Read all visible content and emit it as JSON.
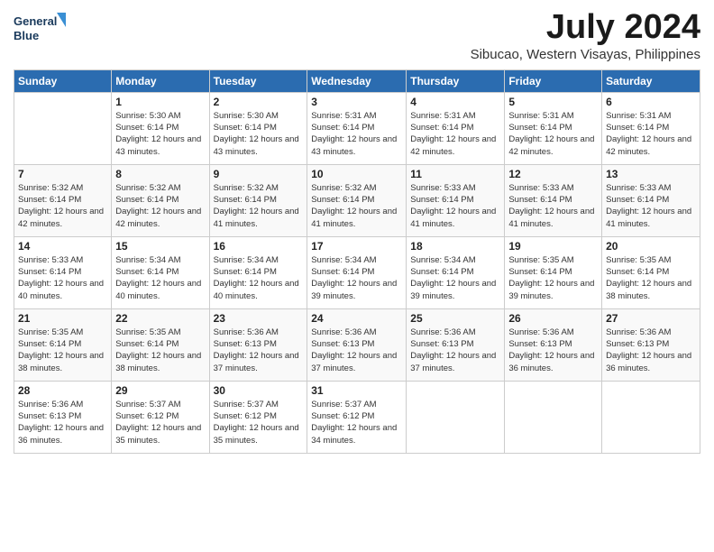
{
  "logo": {
    "line1": "General",
    "line2": "Blue"
  },
  "title": "July 2024",
  "location": "Sibucao, Western Visayas, Philippines",
  "weekdays": [
    "Sunday",
    "Monday",
    "Tuesday",
    "Wednesday",
    "Thursday",
    "Friday",
    "Saturday"
  ],
  "weeks": [
    [
      {
        "day": "",
        "sunrise": "",
        "sunset": "",
        "daylight": ""
      },
      {
        "day": "1",
        "sunrise": "Sunrise: 5:30 AM",
        "sunset": "Sunset: 6:14 PM",
        "daylight": "Daylight: 12 hours and 43 minutes."
      },
      {
        "day": "2",
        "sunrise": "Sunrise: 5:30 AM",
        "sunset": "Sunset: 6:14 PM",
        "daylight": "Daylight: 12 hours and 43 minutes."
      },
      {
        "day": "3",
        "sunrise": "Sunrise: 5:31 AM",
        "sunset": "Sunset: 6:14 PM",
        "daylight": "Daylight: 12 hours and 43 minutes."
      },
      {
        "day": "4",
        "sunrise": "Sunrise: 5:31 AM",
        "sunset": "Sunset: 6:14 PM",
        "daylight": "Daylight: 12 hours and 42 minutes."
      },
      {
        "day": "5",
        "sunrise": "Sunrise: 5:31 AM",
        "sunset": "Sunset: 6:14 PM",
        "daylight": "Daylight: 12 hours and 42 minutes."
      },
      {
        "day": "6",
        "sunrise": "Sunrise: 5:31 AM",
        "sunset": "Sunset: 6:14 PM",
        "daylight": "Daylight: 12 hours and 42 minutes."
      }
    ],
    [
      {
        "day": "7",
        "sunrise": "Sunrise: 5:32 AM",
        "sunset": "Sunset: 6:14 PM",
        "daylight": "Daylight: 12 hours and 42 minutes."
      },
      {
        "day": "8",
        "sunrise": "Sunrise: 5:32 AM",
        "sunset": "Sunset: 6:14 PM",
        "daylight": "Daylight: 12 hours and 42 minutes."
      },
      {
        "day": "9",
        "sunrise": "Sunrise: 5:32 AM",
        "sunset": "Sunset: 6:14 PM",
        "daylight": "Daylight: 12 hours and 41 minutes."
      },
      {
        "day": "10",
        "sunrise": "Sunrise: 5:32 AM",
        "sunset": "Sunset: 6:14 PM",
        "daylight": "Daylight: 12 hours and 41 minutes."
      },
      {
        "day": "11",
        "sunrise": "Sunrise: 5:33 AM",
        "sunset": "Sunset: 6:14 PM",
        "daylight": "Daylight: 12 hours and 41 minutes."
      },
      {
        "day": "12",
        "sunrise": "Sunrise: 5:33 AM",
        "sunset": "Sunset: 6:14 PM",
        "daylight": "Daylight: 12 hours and 41 minutes."
      },
      {
        "day": "13",
        "sunrise": "Sunrise: 5:33 AM",
        "sunset": "Sunset: 6:14 PM",
        "daylight": "Daylight: 12 hours and 41 minutes."
      }
    ],
    [
      {
        "day": "14",
        "sunrise": "Sunrise: 5:33 AM",
        "sunset": "Sunset: 6:14 PM",
        "daylight": "Daylight: 12 hours and 40 minutes."
      },
      {
        "day": "15",
        "sunrise": "Sunrise: 5:34 AM",
        "sunset": "Sunset: 6:14 PM",
        "daylight": "Daylight: 12 hours and 40 minutes."
      },
      {
        "day": "16",
        "sunrise": "Sunrise: 5:34 AM",
        "sunset": "Sunset: 6:14 PM",
        "daylight": "Daylight: 12 hours and 40 minutes."
      },
      {
        "day": "17",
        "sunrise": "Sunrise: 5:34 AM",
        "sunset": "Sunset: 6:14 PM",
        "daylight": "Daylight: 12 hours and 39 minutes."
      },
      {
        "day": "18",
        "sunrise": "Sunrise: 5:34 AM",
        "sunset": "Sunset: 6:14 PM",
        "daylight": "Daylight: 12 hours and 39 minutes."
      },
      {
        "day": "19",
        "sunrise": "Sunrise: 5:35 AM",
        "sunset": "Sunset: 6:14 PM",
        "daylight": "Daylight: 12 hours and 39 minutes."
      },
      {
        "day": "20",
        "sunrise": "Sunrise: 5:35 AM",
        "sunset": "Sunset: 6:14 PM",
        "daylight": "Daylight: 12 hours and 38 minutes."
      }
    ],
    [
      {
        "day": "21",
        "sunrise": "Sunrise: 5:35 AM",
        "sunset": "Sunset: 6:14 PM",
        "daylight": "Daylight: 12 hours and 38 minutes."
      },
      {
        "day": "22",
        "sunrise": "Sunrise: 5:35 AM",
        "sunset": "Sunset: 6:14 PM",
        "daylight": "Daylight: 12 hours and 38 minutes."
      },
      {
        "day": "23",
        "sunrise": "Sunrise: 5:36 AM",
        "sunset": "Sunset: 6:13 PM",
        "daylight": "Daylight: 12 hours and 37 minutes."
      },
      {
        "day": "24",
        "sunrise": "Sunrise: 5:36 AM",
        "sunset": "Sunset: 6:13 PM",
        "daylight": "Daylight: 12 hours and 37 minutes."
      },
      {
        "day": "25",
        "sunrise": "Sunrise: 5:36 AM",
        "sunset": "Sunset: 6:13 PM",
        "daylight": "Daylight: 12 hours and 37 minutes."
      },
      {
        "day": "26",
        "sunrise": "Sunrise: 5:36 AM",
        "sunset": "Sunset: 6:13 PM",
        "daylight": "Daylight: 12 hours and 36 minutes."
      },
      {
        "day": "27",
        "sunrise": "Sunrise: 5:36 AM",
        "sunset": "Sunset: 6:13 PM",
        "daylight": "Daylight: 12 hours and 36 minutes."
      }
    ],
    [
      {
        "day": "28",
        "sunrise": "Sunrise: 5:36 AM",
        "sunset": "Sunset: 6:13 PM",
        "daylight": "Daylight: 12 hours and 36 minutes."
      },
      {
        "day": "29",
        "sunrise": "Sunrise: 5:37 AM",
        "sunset": "Sunset: 6:12 PM",
        "daylight": "Daylight: 12 hours and 35 minutes."
      },
      {
        "day": "30",
        "sunrise": "Sunrise: 5:37 AM",
        "sunset": "Sunset: 6:12 PM",
        "daylight": "Daylight: 12 hours and 35 minutes."
      },
      {
        "day": "31",
        "sunrise": "Sunrise: 5:37 AM",
        "sunset": "Sunset: 6:12 PM",
        "daylight": "Daylight: 12 hours and 34 minutes."
      },
      {
        "day": "",
        "sunrise": "",
        "sunset": "",
        "daylight": ""
      },
      {
        "day": "",
        "sunrise": "",
        "sunset": "",
        "daylight": ""
      },
      {
        "day": "",
        "sunrise": "",
        "sunset": "",
        "daylight": ""
      }
    ]
  ]
}
